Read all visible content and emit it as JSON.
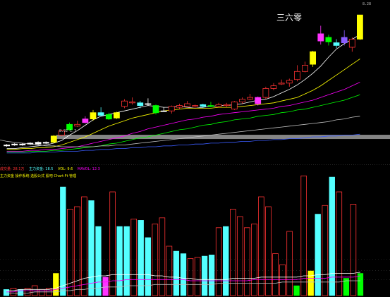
{
  "stock_name": "三六零",
  "max_price_label": "8.28",
  "percent_label": "8.92 1.3",
  "colors": {
    "up": "#ff3232",
    "down": "#54ffff",
    "up_fill": "#ffff00",
    "ma5": "#ffffff",
    "ma10": "#ffff00",
    "ma20": "#ff00ff",
    "ma30": "#00ff00",
    "ma60": "#c0c0c0",
    "ma120": "#3b5cff"
  },
  "legend1": [
    {
      "text": "成交量: 28.1万",
      "color": "#ff3232"
    },
    {
      "text": "主力资金: 18.5",
      "color": "#54ffff"
    },
    {
      "text": "VOL: 9.6",
      "color": "#ffff00"
    },
    {
      "text": "MAVOL: 12.3",
      "color": "#ff00ff"
    }
  ],
  "legend2": [
    {
      "text": "主力资金 操作系统 选股公式 股吧 Chart·Ft 管理",
      "color": "#ffff00"
    }
  ],
  "chart_data": [
    {
      "type": "candlestick",
      "title": "",
      "ylim": [
        6.7,
        8.4
      ],
      "candles": [
        {
          "o": 6.82,
          "c": 6.83,
          "h": 6.84,
          "l": 6.81,
          "color": "white"
        },
        {
          "o": 6.83,
          "c": 6.84,
          "h": 6.85,
          "l": 6.82,
          "color": "white"
        },
        {
          "o": 6.83,
          "c": 6.84,
          "h": 6.85,
          "l": 6.82,
          "color": "white"
        },
        {
          "o": 6.84,
          "c": 6.85,
          "h": 6.86,
          "l": 6.83,
          "color": "white"
        },
        {
          "o": 6.84,
          "c": 6.86,
          "h": 6.87,
          "l": 6.83,
          "color": "white"
        },
        {
          "o": 6.86,
          "c": 6.85,
          "h": 6.87,
          "l": 6.84,
          "color": "white"
        },
        {
          "o": 6.86,
          "c": 6.93,
          "h": 6.94,
          "l": 6.85,
          "color": "yellow"
        },
        {
          "o": 6.94,
          "c": 6.99,
          "h": 7.0,
          "l": 6.93,
          "color": "red"
        },
        {
          "o": 7.0,
          "c": 7.06,
          "h": 7.08,
          "l": 6.99,
          "color": "green"
        },
        {
          "o": 7.04,
          "c": 7.06,
          "h": 7.1,
          "l": 7.03,
          "color": "red"
        },
        {
          "o": 7.08,
          "c": 7.12,
          "h": 7.15,
          "l": 7.07,
          "color": "magenta"
        },
        {
          "o": 7.12,
          "c": 7.19,
          "h": 7.22,
          "l": 7.1,
          "color": "yellow"
        },
        {
          "o": 7.19,
          "c": 7.16,
          "h": 7.25,
          "l": 7.15,
          "color": "cyan"
        },
        {
          "o": 7.12,
          "c": 7.17,
          "h": 7.19,
          "l": 7.11,
          "color": "green"
        },
        {
          "o": 7.13,
          "c": 7.19,
          "h": 7.2,
          "l": 7.12,
          "color": "yellow"
        },
        {
          "o": 7.26,
          "c": 7.32,
          "h": 7.34,
          "l": 7.24,
          "color": "red"
        },
        {
          "o": 7.31,
          "c": 7.3,
          "h": 7.36,
          "l": 7.28,
          "color": "red"
        },
        {
          "o": 7.3,
          "c": 7.27,
          "h": 7.32,
          "l": 7.24,
          "color": "cyan"
        },
        {
          "o": 7.29,
          "c": 7.29,
          "h": 7.35,
          "l": 7.27,
          "color": "white"
        },
        {
          "o": 7.27,
          "c": 7.19,
          "h": 7.28,
          "l": 7.17,
          "color": "green"
        },
        {
          "o": 7.21,
          "c": 7.21,
          "h": 7.25,
          "l": 7.2,
          "color": "white"
        },
        {
          "o": 7.21,
          "c": 7.26,
          "h": 7.27,
          "l": 7.18,
          "color": "red"
        },
        {
          "o": 7.25,
          "c": 7.27,
          "h": 7.29,
          "l": 7.23,
          "color": "red"
        },
        {
          "o": 7.26,
          "c": 7.29,
          "h": 7.32,
          "l": 7.25,
          "color": "red"
        },
        {
          "o": 7.26,
          "c": 7.27,
          "h": 7.28,
          "l": 7.24,
          "color": "red"
        },
        {
          "o": 7.28,
          "c": 7.26,
          "h": 7.29,
          "l": 7.24,
          "color": "cyan"
        },
        {
          "o": 7.26,
          "c": 7.27,
          "h": 7.31,
          "l": 7.25,
          "color": "green"
        },
        {
          "o": 7.26,
          "c": 7.28,
          "h": 7.3,
          "l": 7.25,
          "color": "red"
        },
        {
          "o": 7.27,
          "c": 7.28,
          "h": 7.3,
          "l": 7.25,
          "color": "red"
        },
        {
          "o": 7.23,
          "c": 7.31,
          "h": 7.32,
          "l": 7.22,
          "color": "red"
        },
        {
          "o": 7.31,
          "c": 7.34,
          "h": 7.36,
          "l": 7.29,
          "color": "red"
        },
        {
          "o": 7.34,
          "c": 7.36,
          "h": 7.4,
          "l": 7.33,
          "color": "red"
        },
        {
          "o": 7.36,
          "c": 7.29,
          "h": 7.37,
          "l": 7.27,
          "color": "magenta"
        },
        {
          "o": 7.36,
          "c": 7.46,
          "h": 7.48,
          "l": 7.34,
          "color": "red"
        },
        {
          "o": 7.46,
          "c": 7.49,
          "h": 7.52,
          "l": 7.44,
          "color": "red"
        },
        {
          "o": 7.51,
          "c": 7.52,
          "h": 7.56,
          "l": 7.5,
          "color": "red"
        },
        {
          "o": 7.52,
          "c": 7.55,
          "h": 7.57,
          "l": 7.48,
          "color": "red"
        },
        {
          "o": 7.56,
          "c": 7.65,
          "h": 7.72,
          "l": 7.54,
          "color": "red"
        },
        {
          "o": 7.65,
          "c": 7.72,
          "h": 7.76,
          "l": 7.64,
          "color": "red"
        },
        {
          "o": 7.73,
          "c": 7.87,
          "h": 7.88,
          "l": 7.7,
          "color": "yellow"
        },
        {
          "o": 8.07,
          "c": 7.99,
          "h": 8.16,
          "l": 7.95,
          "color": "magenta"
        },
        {
          "o": 8.03,
          "c": 7.98,
          "h": 8.06,
          "l": 7.94,
          "color": "green"
        },
        {
          "o": 7.97,
          "c": 7.94,
          "h": 8.01,
          "l": 7.91,
          "color": "cyan"
        },
        {
          "o": 7.97,
          "c": 8.03,
          "h": 8.11,
          "l": 7.94,
          "color": "purple"
        },
        {
          "o": 8.01,
          "c": 7.92,
          "h": 8.03,
          "l": 7.87,
          "color": "red"
        },
        {
          "o": 8.01,
          "c": 8.28,
          "h": 8.28,
          "l": 8.0,
          "color": "yellow"
        }
      ],
      "ma_series": [
        {
          "key": "ma5",
          "values": [
            6.79,
            6.79,
            6.8,
            6.81,
            6.82,
            6.83,
            6.85,
            6.88,
            6.94,
            6.99,
            7.05,
            7.11,
            7.15,
            7.17,
            7.19,
            7.21,
            7.23,
            7.25,
            7.27,
            7.26,
            7.25,
            7.25,
            7.26,
            7.25,
            7.24,
            7.25,
            7.26,
            7.27,
            7.27,
            7.28,
            7.29,
            7.31,
            7.33,
            7.34,
            7.37,
            7.41,
            7.45,
            7.5,
            7.56,
            7.63,
            7.71,
            7.81,
            7.9,
            7.96,
            8.01,
            8.06
          ]
        },
        {
          "key": "ma10",
          "values": [
            6.78,
            6.78,
            6.79,
            6.79,
            6.8,
            6.8,
            6.81,
            6.83,
            6.86,
            6.89,
            6.92,
            6.96,
            7.0,
            7.04,
            7.07,
            7.1,
            7.13,
            7.15,
            7.17,
            7.19,
            7.21,
            7.22,
            7.23,
            7.24,
            7.24,
            7.24,
            7.24,
            7.25,
            7.25,
            7.25,
            7.26,
            7.27,
            7.28,
            7.29,
            7.3,
            7.32,
            7.34,
            7.36,
            7.4,
            7.44,
            7.49,
            7.55,
            7.61,
            7.67,
            7.73,
            7.79
          ]
        },
        {
          "key": "ma20",
          "values": [
            6.76,
            6.76,
            6.76,
            6.77,
            6.77,
            6.78,
            6.78,
            6.79,
            6.8,
            6.81,
            6.83,
            6.85,
            6.87,
            6.89,
            6.91,
            6.93,
            6.96,
            6.98,
            7.01,
            7.03,
            7.05,
            7.07,
            7.09,
            7.11,
            7.12,
            7.14,
            7.15,
            7.17,
            7.18,
            7.19,
            7.2,
            7.21,
            7.22,
            7.23,
            7.24,
            7.26,
            7.27,
            7.29,
            7.31,
            7.33,
            7.36,
            7.39,
            7.42,
            7.45,
            7.49,
            7.53
          ]
        },
        {
          "key": "ma30",
          "values": [
            6.75,
            6.75,
            6.75,
            6.76,
            6.76,
            6.76,
            6.77,
            6.77,
            6.78,
            6.79,
            6.8,
            6.81,
            6.82,
            6.84,
            6.85,
            6.87,
            6.89,
            6.91,
            6.92,
            6.94,
            6.96,
            6.98,
            7.0,
            7.01,
            7.03,
            7.05,
            7.06,
            7.08,
            7.09,
            7.11,
            7.12,
            7.13,
            7.15,
            7.16,
            7.17,
            7.19,
            7.2,
            7.22,
            7.23,
            7.25,
            7.27,
            7.29,
            7.31,
            7.33,
            7.36,
            7.39
          ]
        },
        {
          "key": "ma60",
          "values": [
            6.87,
            6.86,
            6.85,
            6.84,
            6.83,
            6.82,
            6.82,
            6.81,
            6.81,
            6.81,
            6.81,
            6.81,
            6.82,
            6.82,
            6.83,
            6.83,
            6.84,
            6.85,
            6.86,
            6.87,
            6.88,
            6.89,
            6.9,
            6.91,
            6.92,
            6.93,
            6.94,
            6.95,
            6.96,
            6.97,
            6.98,
            6.99,
            7.0,
            7.01,
            7.02,
            7.03,
            7.04,
            7.05,
            7.06,
            7.07,
            7.08,
            7.09,
            7.11,
            7.12,
            7.14,
            7.15
          ]
        },
        {
          "key": "ma120",
          "values": [
            6.74,
            6.74,
            6.74,
            6.74,
            6.75,
            6.75,
            6.75,
            6.76,
            6.76,
            6.76,
            6.77,
            6.77,
            6.78,
            6.78,
            6.79,
            6.79,
            6.8,
            6.8,
            6.81,
            6.81,
            6.82,
            6.82,
            6.83,
            6.83,
            6.84,
            6.84,
            6.85,
            6.85,
            6.86,
            6.86,
            6.87,
            6.87,
            6.88,
            6.88,
            6.89,
            6.89,
            6.9,
            6.9,
            6.91,
            6.92,
            6.92,
            6.93,
            6.93,
            6.94,
            6.94,
            6.95
          ]
        }
      ],
      "support_level": 6.92
    },
    {
      "type": "bar",
      "title": "",
      "ylim": [
        0,
        100
      ],
      "bars": [
        {
          "v": 5,
          "style": "cyan"
        },
        {
          "v": 6,
          "style": "outline"
        },
        {
          "v": 5,
          "style": "cyan"
        },
        {
          "v": 6,
          "style": "outline"
        },
        {
          "v": 8,
          "style": "outline"
        },
        {
          "v": 5,
          "style": "outline"
        },
        {
          "v": 6,
          "style": "outline"
        },
        {
          "v": 18,
          "style": "yellow"
        },
        {
          "v": 88,
          "style": "cyan"
        },
        {
          "v": 70,
          "style": "outline"
        },
        {
          "v": 72,
          "style": "outline"
        },
        {
          "v": 80,
          "style": "outline"
        },
        {
          "v": 77,
          "style": "cyan"
        },
        {
          "v": 56,
          "style": "cyan"
        },
        {
          "v": 15,
          "style": "magenta"
        },
        {
          "v": 84,
          "style": "outline"
        },
        {
          "v": 56,
          "style": "cyan"
        },
        {
          "v": 56,
          "style": "cyan"
        },
        {
          "v": 62,
          "style": "outline"
        },
        {
          "v": 61,
          "style": "cyan"
        },
        {
          "v": 47,
          "style": "cyan"
        },
        {
          "v": 58,
          "style": "outline"
        },
        {
          "v": 63,
          "style": "outline"
        },
        {
          "v": 40,
          "style": "outline"
        },
        {
          "v": 36,
          "style": "cyan"
        },
        {
          "v": 34,
          "style": "cyan"
        },
        {
          "v": 30,
          "style": "outline"
        },
        {
          "v": 31,
          "style": "outline"
        },
        {
          "v": 32,
          "style": "cyan"
        },
        {
          "v": 33,
          "style": "cyan"
        },
        {
          "v": 55,
          "style": "outline"
        },
        {
          "v": 56,
          "style": "cyan"
        },
        {
          "v": 70,
          "style": "outline"
        },
        {
          "v": 64,
          "style": "outline"
        },
        {
          "v": 55,
          "style": "outline"
        },
        {
          "v": 58,
          "style": "outline"
        },
        {
          "v": 80,
          "style": "outline"
        },
        {
          "v": 72,
          "style": "outline"
        },
        {
          "v": 34,
          "style": "outline"
        },
        {
          "v": 25,
          "style": "outline"
        },
        {
          "v": 52,
          "style": "outline"
        },
        {
          "v": 8,
          "style": "green"
        },
        {
          "v": 97,
          "style": "outline"
        },
        {
          "v": 20,
          "style": "yellow"
        },
        {
          "v": 66,
          "style": "cyan"
        },
        {
          "v": 73,
          "style": "outline"
        },
        {
          "v": 96,
          "style": "cyan"
        },
        {
          "v": 84,
          "style": "outline"
        },
        {
          "v": 14,
          "style": "green"
        },
        {
          "v": 74,
          "style": "outline"
        },
        {
          "v": 18,
          "style": "green"
        }
      ],
      "lines": [
        {
          "key": "ma5",
          "values": [
            4,
            4,
            5,
            5,
            5,
            5,
            5,
            6,
            8,
            10,
            12,
            14,
            15,
            16,
            16,
            17,
            17,
            17,
            17,
            17,
            17,
            16,
            16,
            15,
            15,
            14,
            14,
            13,
            13,
            13,
            13,
            13,
            14,
            14,
            14,
            14,
            15,
            15,
            15,
            15,
            15,
            15,
            16,
            16,
            17,
            17,
            18,
            18,
            18,
            18,
            19
          ]
        },
        {
          "key": "ma20",
          "values": [
            3,
            3,
            4,
            4,
            4,
            4,
            4,
            5,
            6,
            7,
            8,
            9,
            10,
            11,
            11,
            12,
            12,
            13,
            13,
            13,
            13,
            13,
            13,
            13,
            13,
            13,
            12,
            12,
            12,
            12,
            12,
            12,
            12,
            12,
            12,
            13,
            13,
            13,
            13,
            13,
            13,
            13,
            14,
            14,
            14,
            14,
            15,
            15,
            15,
            15,
            16
          ]
        },
        {
          "key": "ma60",
          "values": [
            2,
            2,
            2,
            2,
            3,
            3,
            3,
            3,
            4,
            4,
            5,
            5,
            6,
            6,
            7,
            7,
            7,
            8,
            8,
            8,
            8,
            9,
            9,
            9,
            9,
            9,
            9,
            9,
            9,
            9,
            10,
            10,
            10,
            10,
            10,
            10,
            10,
            10,
            10,
            11,
            11,
            11,
            11,
            11,
            11,
            11,
            11,
            11,
            12,
            12,
            12
          ]
        }
      ]
    }
  ]
}
